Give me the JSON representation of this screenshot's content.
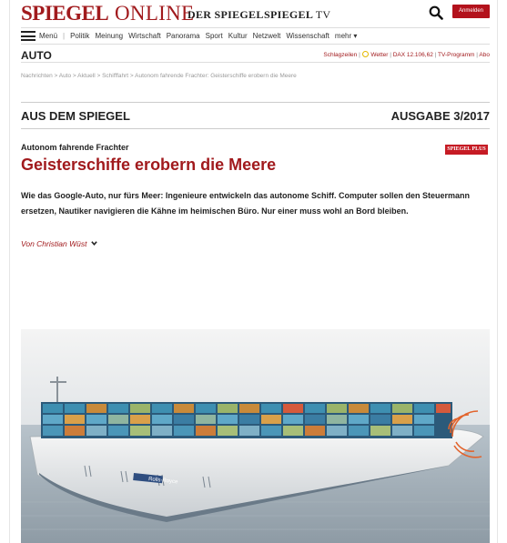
{
  "header": {
    "logo_spiegel": "SPIEGEL",
    "logo_online": "ONLINE",
    "brand_der_spiegel": "DER SPIEGEL",
    "brand_spiegel": "SPIEGEL",
    "brand_tv": "TV",
    "login_label": "Anmelden"
  },
  "nav": {
    "menu_label": "Menü",
    "items": [
      "Politik",
      "Meinung",
      "Wirtschaft",
      "Panorama",
      "Sport",
      "Kultur",
      "Netzwelt",
      "Wissenschaft",
      "mehr ▾"
    ]
  },
  "section": {
    "title": "AUTO",
    "link_schlagzeilen": "Schlagzeilen",
    "link_wetter": "Wetter",
    "dax": "DAX 12.106,62",
    "link_tvprogramm": "TV-Programm",
    "link_abo": "Abo"
  },
  "breadcrumb": "Nachrichten > Auto > Aktuell > Schifffahrt > Autonom fahrende Frachter: Geisterschiffe erobern die Meere",
  "banner": {
    "title": "AUS DEM SPIEGEL",
    "issue": "AUSGABE 3/2017"
  },
  "article": {
    "kicker": "Autonom fahrende Frachter",
    "badge": "SPIEGEL PLUS",
    "headline": "Geisterschiffe erobern die Meere",
    "teaser": "Wie das Google-Auto, nur fürs Meer: Ingenieure entwickeln das autonome Schiff. Computer sollen den Steuermann ersetzen, Nautiker navigieren die Kähne im heimischen Büro. Nur einer muss wohl an Bord bleiben.",
    "author": "Von Christian Wüst",
    "image_hull_brand": "Rolls-Royce"
  },
  "colors": {
    "brand_red": "#a11a1d",
    "button_red": "#b3121c"
  }
}
